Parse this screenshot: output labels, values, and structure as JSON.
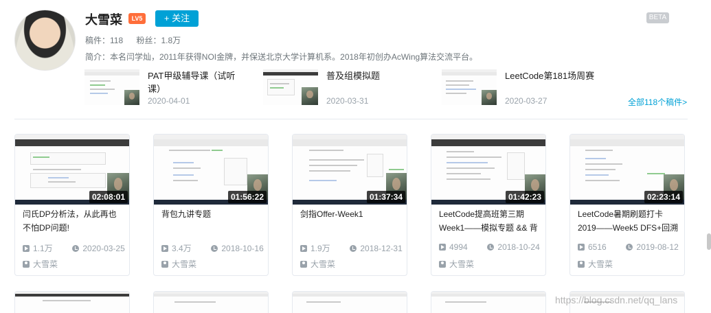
{
  "profile": {
    "name": "大雪菜",
    "level": "LV5",
    "follow_label": "+ 关注",
    "beta_label": "BETA",
    "stats": {
      "videos": "稿件：118",
      "fans": "粉丝：1.8万"
    },
    "intro": "简介：本名闫学灿，2011年获得NOI金牌，并保送北京大学计算机系。2018年初创办AcWing算法交流平台。"
  },
  "recent": [
    {
      "title": "PAT甲级辅导课（试听课）",
      "date": "2020-04-01"
    },
    {
      "title": "普及组模拟题",
      "date": "2020-03-31"
    },
    {
      "title": "LeetCode第181场周赛",
      "date": "2020-03-27"
    }
  ],
  "all_link": "全部118个稿件>",
  "videos": [
    {
      "duration": "02:08:01",
      "title": "闫氏DP分析法，从此再也不怕DP问题!",
      "plays": "1.1万",
      "date": "2020-03-25",
      "author": "大雪菜"
    },
    {
      "duration": "01:56:22",
      "title": "背包九讲专题",
      "plays": "3.4万",
      "date": "2018-10-16",
      "author": "大雪菜"
    },
    {
      "duration": "01:37:34",
      "title": "剑指Offer-Week1",
      "plays": "1.9万",
      "date": "2018-12-31",
      "author": "大雪菜"
    },
    {
      "duration": "01:42:23",
      "title": "LeetCode提高班第三期Week1——模拟专题 && 背",
      "plays": "4994",
      "date": "2018-10-24",
      "author": "大雪菜"
    },
    {
      "duration": "02:23:14",
      "title": "LeetCode暑期刷题打卡2019——Week5 DFS+回溯",
      "plays": "6516",
      "date": "2019-08-12",
      "author": "大雪菜"
    }
  ],
  "watermark": "https://blog.csdn.net/qq_lans"
}
